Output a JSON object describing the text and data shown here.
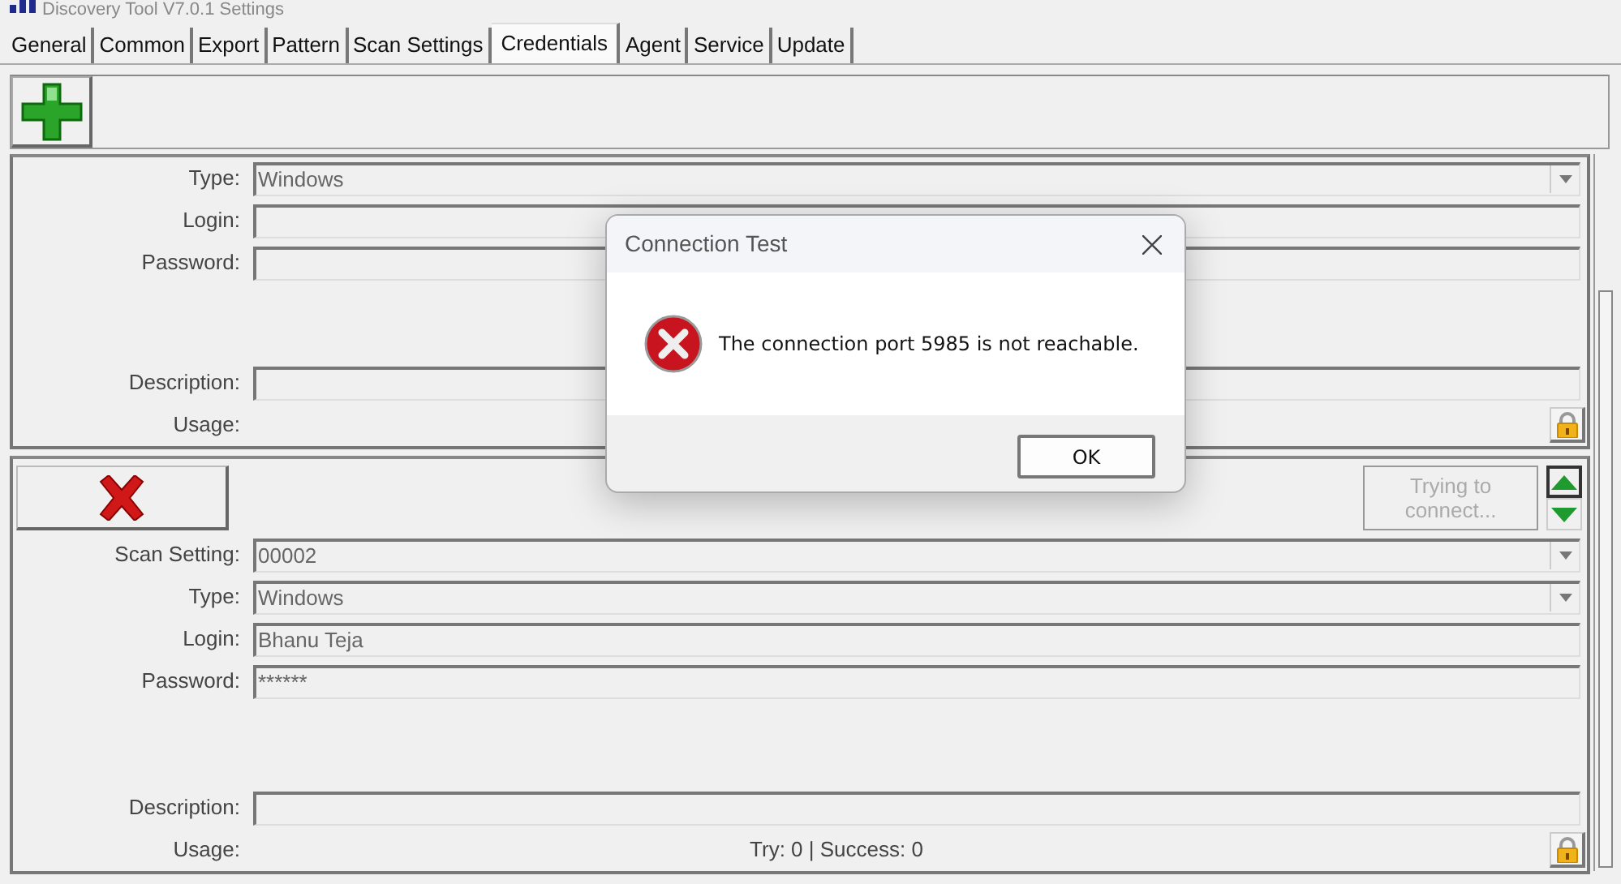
{
  "window": {
    "title": "Discovery Tool V7.0.1 Settings"
  },
  "tabs": [
    {
      "label": "General",
      "selected": false
    },
    {
      "label": "Common",
      "selected": false
    },
    {
      "label": "Export",
      "selected": false
    },
    {
      "label": "Pattern",
      "selected": false
    },
    {
      "label": "Scan Settings",
      "selected": false
    },
    {
      "label": "Credentials",
      "selected": true
    },
    {
      "label": "Agent",
      "selected": false
    },
    {
      "label": "Service",
      "selected": false
    },
    {
      "label": "Update",
      "selected": false
    }
  ],
  "credentials": [
    {
      "fields": [
        {
          "label": "Type:",
          "value": "Windows",
          "kind": "dropdown"
        },
        {
          "label": "Login:",
          "kind": "text"
        },
        {
          "label": "Password:",
          "kind": "text"
        },
        {
          "kind": "gap"
        },
        {
          "label": "Description:",
          "kind": "text"
        },
        {
          "label": "Usage:",
          "kind": "usage"
        }
      ]
    },
    {
      "header": {
        "status_button": {
          "label": "Trying to connect...",
          "disabled": true
        }
      },
      "fields": [
        {
          "label": "Scan Setting:",
          "value": "00002",
          "kind": "dropdown"
        },
        {
          "label": "Type:",
          "value": "Windows",
          "kind": "dropdown"
        },
        {
          "label": "Login:",
          "value": "Bhanu Teja",
          "kind": "text"
        },
        {
          "label": "Password:",
          "value": "******",
          "kind": "text"
        },
        {
          "kind": "gap"
        },
        {
          "label": "Description:",
          "kind": "text"
        },
        {
          "label": "Usage:",
          "value": "Try: 0 | Success: 0",
          "kind": "usage"
        }
      ]
    }
  ],
  "dialog": {
    "title": "Connection Test",
    "message": "The connection port 5985 is not reachable.",
    "buttons": [
      "OK"
    ]
  }
}
